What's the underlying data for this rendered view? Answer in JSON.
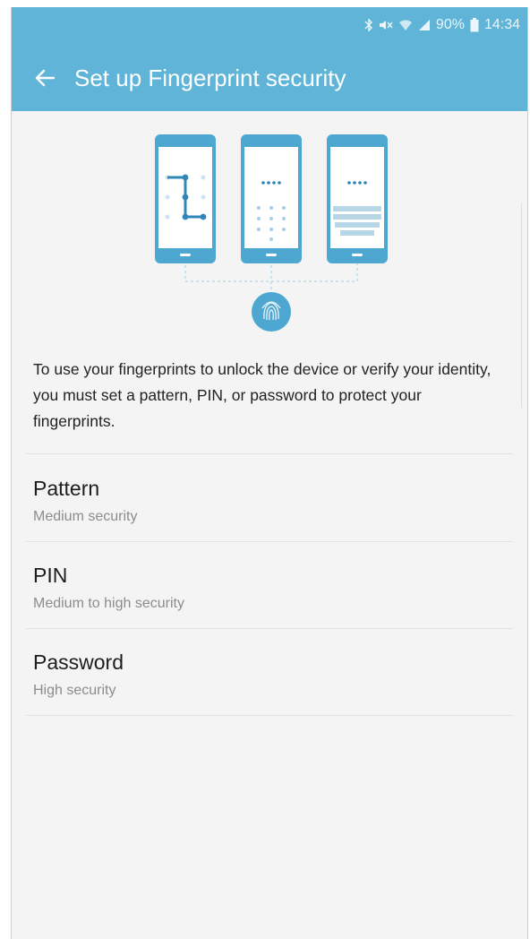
{
  "status_bar": {
    "icons": [
      "bluetooth-icon",
      "mute-icon",
      "wifi-icon",
      "signal-icon",
      "battery-icon"
    ],
    "battery": "90%",
    "time": "14:34"
  },
  "header": {
    "title": "Set up Fingerprint security",
    "back_icon": "arrow-left-icon",
    "background": "#5fb4d8"
  },
  "description": "To use your fingerprints to unlock the device or verify your identity, you must set a pattern, PIN, or password to protect your fingerprints.",
  "options": [
    {
      "label": "Pattern",
      "sub": "Medium security"
    },
    {
      "label": "PIN",
      "sub": "Medium to high security"
    },
    {
      "label": "Password",
      "sub": "High security"
    }
  ],
  "colors": {
    "accent": "#5fb4d8",
    "illustration": "#4ea7d1",
    "background": "#f4f4f4"
  }
}
